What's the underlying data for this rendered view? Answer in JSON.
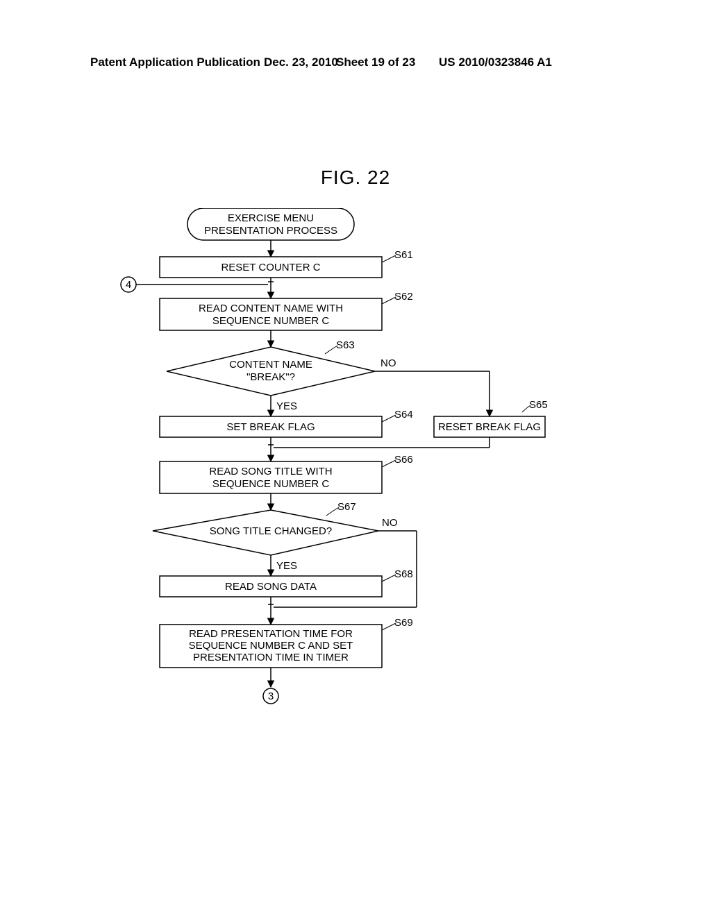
{
  "header": {
    "left": "Patent Application Publication",
    "date": "Dec. 23, 2010",
    "sheet": "Sheet 19 of 23",
    "pubno": "US 2010/0323846 A1"
  },
  "figure_title": "FIG. 22",
  "flow": {
    "start": "EXERCISE MENU\nPRESENTATION PROCESS",
    "s61": "RESET COUNTER C",
    "s62": "READ CONTENT NAME WITH\nSEQUENCE NUMBER C",
    "s63": "CONTENT NAME\n\"BREAK\"?",
    "s64": "SET BREAK FLAG",
    "s65": "RESET BREAK FLAG",
    "s66": "READ SONG TITLE WITH\nSEQUENCE NUMBER C",
    "s67": "SONG TITLE CHANGED?",
    "s68": "READ SONG DATA",
    "s69": "READ PRESENTATION TIME FOR\nSEQUENCE NUMBER C AND SET\nPRESENTATION TIME IN TIMER"
  },
  "labels": {
    "s61": "S61",
    "s62": "S62",
    "s63": "S63",
    "s64": "S64",
    "s65": "S65",
    "s66": "S66",
    "s67": "S67",
    "s68": "S68",
    "s69": "S69",
    "yes": "YES",
    "no": "NO",
    "conn4": "4",
    "conn3": "3"
  }
}
